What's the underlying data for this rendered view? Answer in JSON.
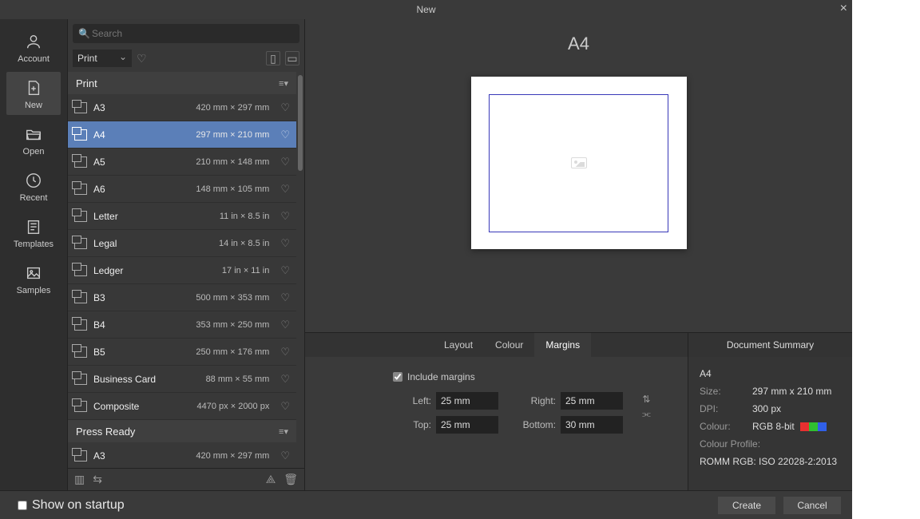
{
  "titlebar": {
    "title": "New"
  },
  "leftnav": {
    "items": [
      {
        "label": "Account"
      },
      {
        "label": "New"
      },
      {
        "label": "Open"
      },
      {
        "label": "Recent"
      },
      {
        "label": "Templates"
      },
      {
        "label": "Samples"
      }
    ]
  },
  "search": {
    "placeholder": "Search"
  },
  "category": {
    "label": "Print"
  },
  "groups": {
    "print": {
      "title": "Print"
    },
    "press_ready": {
      "title": "Press Ready"
    }
  },
  "presets": [
    {
      "name": "A3",
      "dims": "420 mm × 297 mm"
    },
    {
      "name": "A4",
      "dims": "297 mm × 210 mm"
    },
    {
      "name": "A5",
      "dims": "210 mm × 148 mm"
    },
    {
      "name": "A6",
      "dims": "148 mm × 105 mm"
    },
    {
      "name": "Letter",
      "dims": "11 in × 8.5 in"
    },
    {
      "name": "Legal",
      "dims": "14 in × 8.5 in"
    },
    {
      "name": "Ledger",
      "dims": "17 in × 11 in"
    },
    {
      "name": "B3",
      "dims": "500 mm × 353 mm"
    },
    {
      "name": "B4",
      "dims": "353 mm × 250 mm"
    },
    {
      "name": "B5",
      "dims": "250 mm × 176 mm"
    },
    {
      "name": "Business Card",
      "dims": "88 mm × 55 mm"
    },
    {
      "name": "Composite",
      "dims": "4470 px × 2000 px"
    }
  ],
  "press_ready_presets": [
    {
      "name": "A3",
      "dims": "420 mm × 297 mm"
    }
  ],
  "preview": {
    "title": "A4"
  },
  "tabs": [
    {
      "label": "Layout"
    },
    {
      "label": "Colour"
    },
    {
      "label": "Margins"
    }
  ],
  "margins": {
    "include_label": "Include margins",
    "left_label": "Left:",
    "left": "25 mm",
    "right_label": "Right:",
    "right": "25 mm",
    "top_label": "Top:",
    "top": "25 mm",
    "bottom_label": "Bottom:",
    "bottom": "30 mm"
  },
  "summary": {
    "title": "Document Summary",
    "name": "A4",
    "size_label": "Size:",
    "size": "297 mm  x  210 mm",
    "dpi_label": "DPI:",
    "dpi": "300 px",
    "colour_label": "Colour:",
    "colour": "RGB 8-bit",
    "profile_label": "Colour Profile:",
    "profile": "ROMM RGB: ISO 22028-2:2013",
    "swatches": [
      "#e83030",
      "#30c030",
      "#3060e8"
    ]
  },
  "footer": {
    "show_on_startup": "Show on startup",
    "create": "Create",
    "cancel": "Cancel"
  }
}
